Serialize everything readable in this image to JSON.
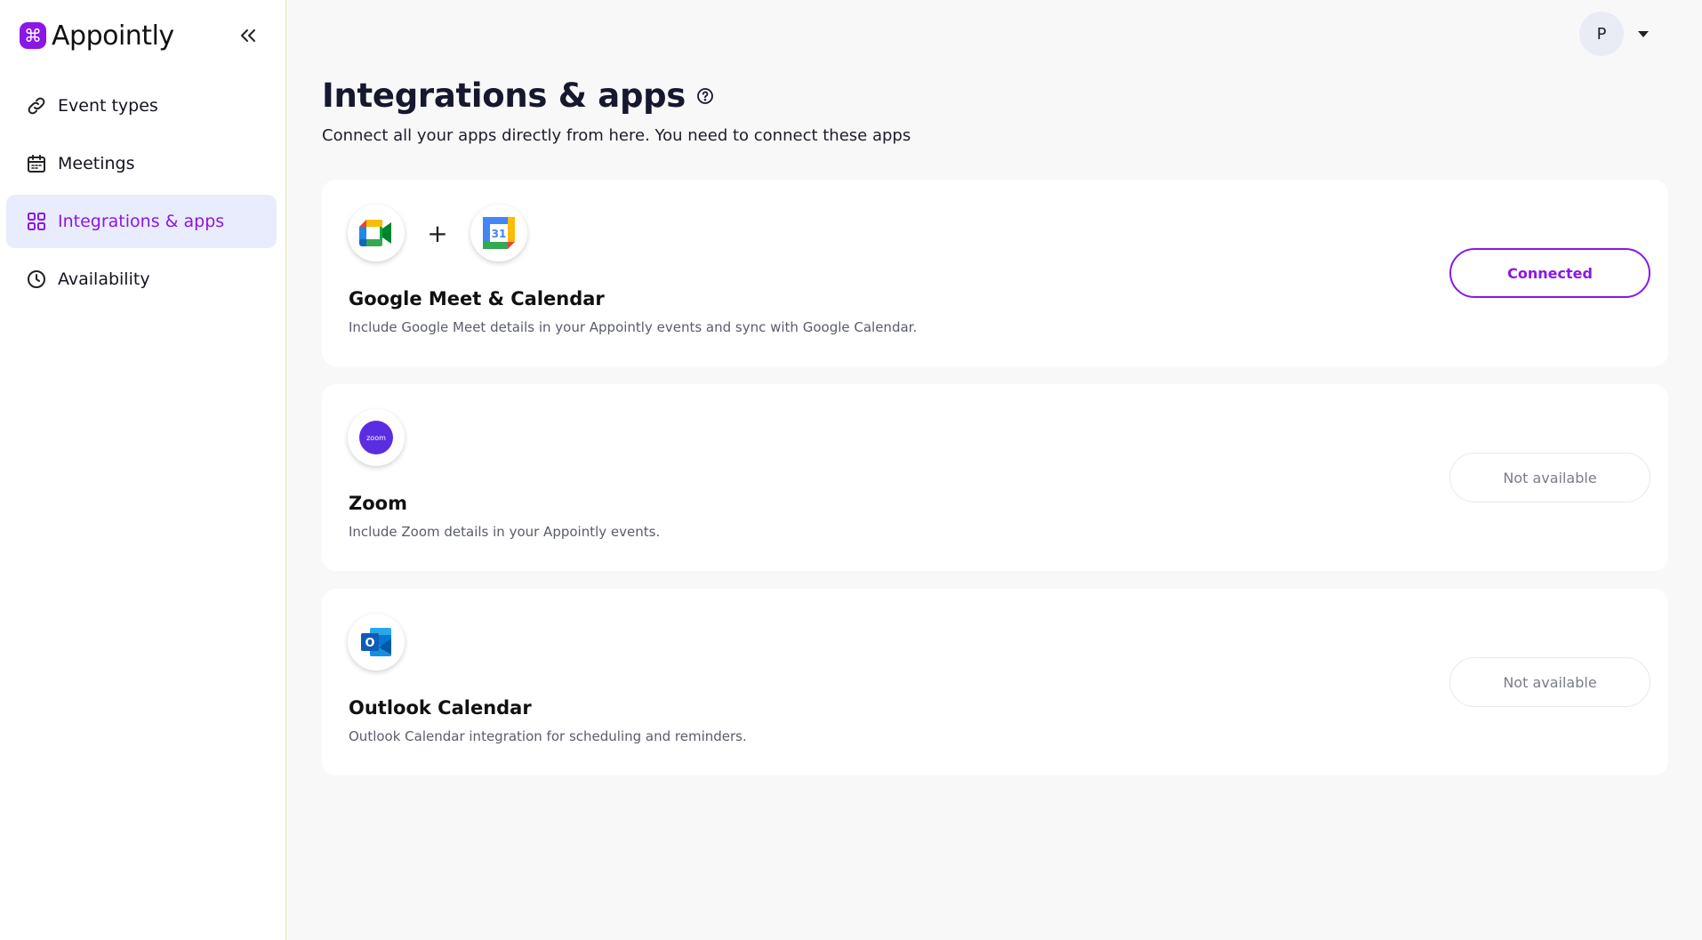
{
  "brand": {
    "name": "Appointly",
    "logo_glyph": "⌘",
    "accent": "#8a17e6"
  },
  "sidebar": {
    "collapse_icon": "double-chevron-left-icon",
    "items": [
      {
        "label": "Event types",
        "icon": "link-icon",
        "active": false
      },
      {
        "label": "Meetings",
        "icon": "calendar-icon",
        "active": false
      },
      {
        "label": "Integrations & apps",
        "icon": "grid-icon",
        "active": true
      },
      {
        "label": "Availability",
        "icon": "clock-icon",
        "active": false
      }
    ]
  },
  "header": {
    "avatar_initial": "P"
  },
  "page": {
    "title": "Integrations & apps",
    "subtitle": "Connect all your apps directly from here. You need to connect these apps"
  },
  "integrations": [
    {
      "title": "Google Meet & Calendar",
      "description": "Include Google Meet details in your Appointly events and sync with Google Calendar.",
      "status": "Connected",
      "plus": "+",
      "icons": [
        "google-meet-icon",
        "google-calendar-icon"
      ],
      "calendar_day": "31"
    },
    {
      "title": "Zoom",
      "description": "Include Zoom details in your Appointly events.",
      "status": "Not available",
      "icons": [
        "zoom-icon"
      ],
      "icon_text": "zoom"
    },
    {
      "title": "Outlook Calendar",
      "description": "Outlook Calendar integration for scheduling and reminders.",
      "status": "Not available",
      "icons": [
        "outlook-icon"
      ],
      "icon_text": "O"
    }
  ]
}
